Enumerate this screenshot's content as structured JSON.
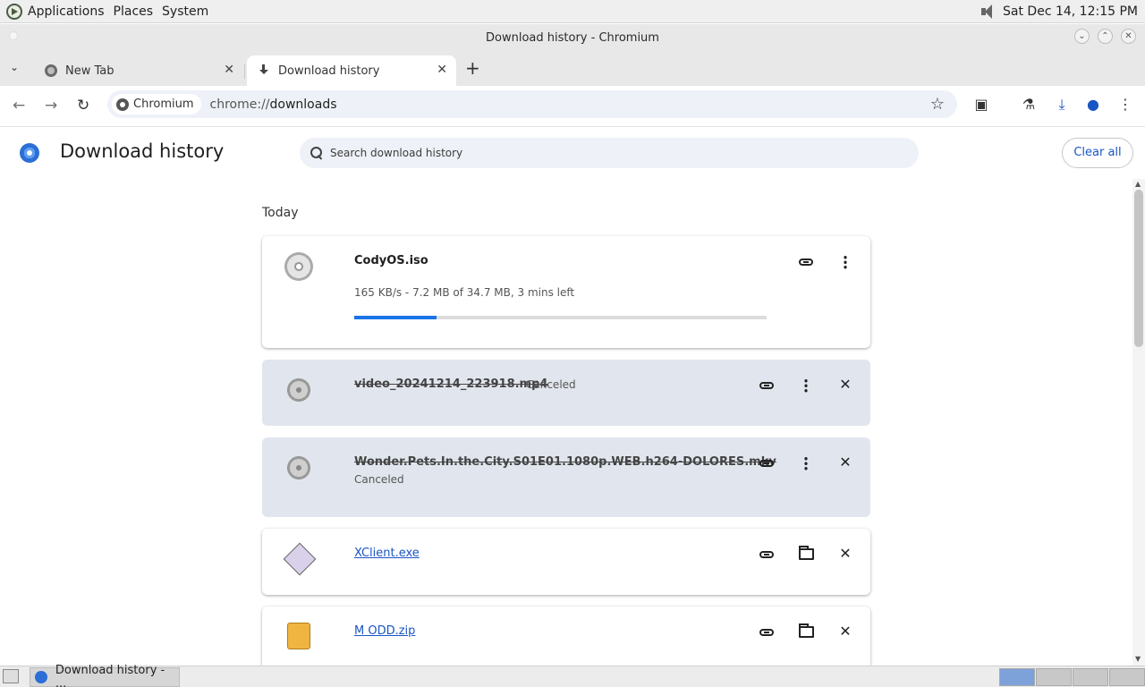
{
  "top_panel": {
    "menus": [
      "Applications",
      "Places",
      "System"
    ],
    "clock": "Sat Dec 14, 12:15 PM"
  },
  "window": {
    "title": "Download history - Chromium"
  },
  "tabs": [
    {
      "label": "New Tab",
      "icon": "globe-icon",
      "active": false
    },
    {
      "label": "Download history",
      "icon": "download-icon",
      "active": true
    }
  ],
  "toolbar": {
    "site_chip": "Chromium",
    "url_prefix": "chrome://",
    "url_host": "downloads"
  },
  "page": {
    "title": "Download history",
    "search_placeholder": "Search download history",
    "clear_all_label": "Clear all",
    "section_label": "Today"
  },
  "downloads": [
    {
      "name": "CodyOS.iso",
      "icon": "disc-icon",
      "state": "in_progress",
      "status": "165 KB/s - 7.2 MB of 34.7 MB, 3 mins left",
      "progress_fraction": 0.2,
      "actions": [
        "link-icon",
        "more-icon"
      ]
    },
    {
      "name": "video_20241214_223918.mp4",
      "icon": "film-reel-icon",
      "state": "canceled",
      "status": "Canceled",
      "actions": [
        "link-icon",
        "more-icon",
        "close-icon"
      ]
    },
    {
      "name": "Wonder.Pets.In.the.City.S01E01.1080p.WEB.h264-DOLORES.mkv",
      "icon": "film-reel-icon",
      "state": "canceled",
      "status": "Canceled",
      "actions": [
        "link-icon",
        "more-icon",
        "close-icon"
      ]
    },
    {
      "name": "XClient.exe",
      "icon": "executable-icon",
      "state": "complete",
      "actions": [
        "link-icon",
        "folder-icon",
        "close-icon"
      ]
    },
    {
      "name": "M ODD.zip",
      "icon": "archive-icon",
      "state": "complete",
      "actions": [
        "link-icon",
        "folder-icon",
        "close-icon"
      ]
    }
  ],
  "taskbar": {
    "task_label": "Download history - ..."
  },
  "colors": {
    "accent": "#1a73e8",
    "link": "#1a55c4",
    "canceled_card": "#e1e6ee"
  }
}
